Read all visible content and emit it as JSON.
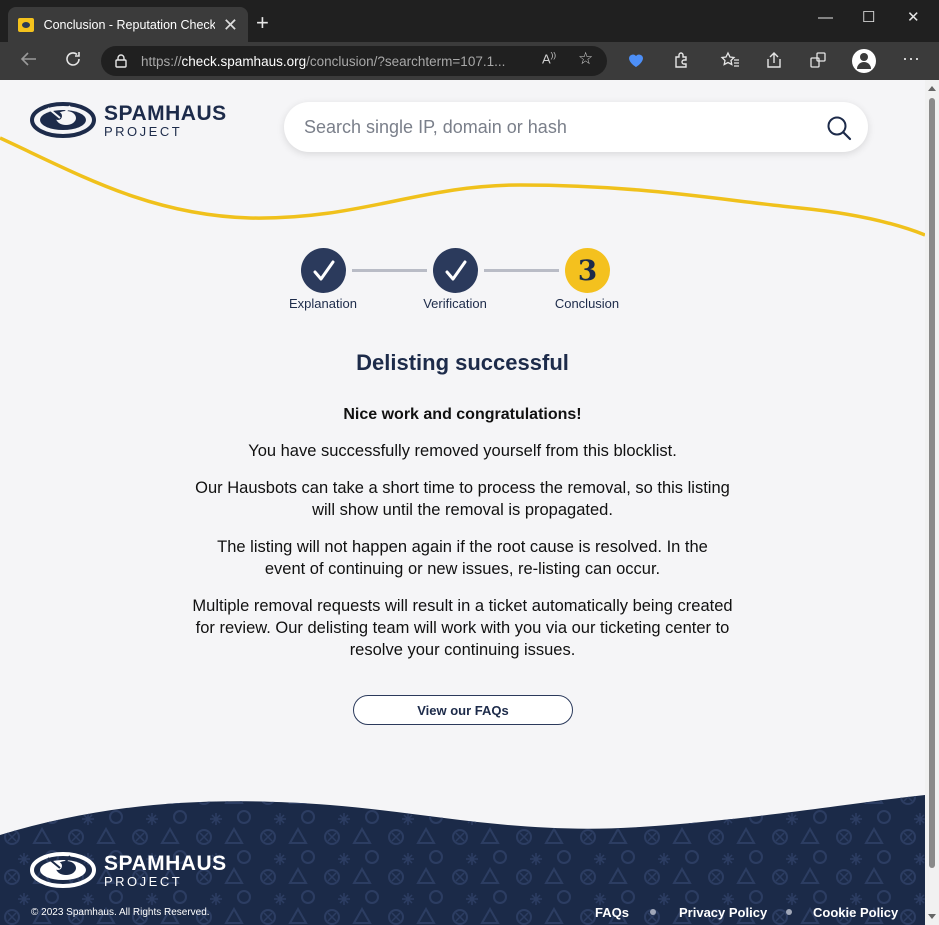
{
  "browser": {
    "tab_title": "Conclusion - Reputation Checker",
    "tab_close": "✕",
    "new_tab": "+",
    "url_scheme": "https://",
    "url_host": "check.spamhaus.org",
    "url_path": "/conclusion/?searchterm=107.1...",
    "window_controls": [
      "—",
      "☐",
      "✕"
    ],
    "icons": [
      "back-icon",
      "refresh-icon",
      "lock-icon",
      "read-aloud-icon",
      "add-favorite-icon",
      "extension-icon",
      "favorites-icon",
      "share-icon",
      "collections-icon",
      "profile-icon",
      "more-icon"
    ]
  },
  "site": {
    "logo_main": "SPAMHAUS",
    "logo_sub": "PROJECT",
    "search_placeholder": "Search single IP, domain or hash"
  },
  "steps": [
    {
      "label": "Explanation",
      "state": "done"
    },
    {
      "label": "Verification",
      "state": "done"
    },
    {
      "label": "Conclusion",
      "state": "current",
      "number": "3"
    }
  ],
  "main": {
    "headline": "Delisting successful",
    "lead": "Nice work and congratulations!",
    "paragraphs": [
      "You have successfully removed yourself from this blocklist.",
      "Our Hausbots can take a short time to process the removal, so this listing will show until the removal is propagated.",
      "The listing will not happen again if the root cause is resolved. In the event of continuing or new issues, re-listing can occur.",
      "Multiple removal requests will result in a ticket automatically being created for review. Our delisting team will work with you via our ticketing center to resolve your continuing issues."
    ],
    "faq_button": "View our FAQs"
  },
  "footer": {
    "logo_main": "SPAMHAUS",
    "logo_sub": "PROJECT",
    "copyright": "© 2023 Spamhaus. All Rights Reserved.",
    "links": [
      "FAQs",
      "Privacy Policy",
      "Cookie Policy"
    ]
  },
  "colors": {
    "navy": "#1d2b4a",
    "yellow": "#f4c11e",
    "page_bg": "#f5f5f7",
    "footer_bg": "#1b2a48"
  }
}
